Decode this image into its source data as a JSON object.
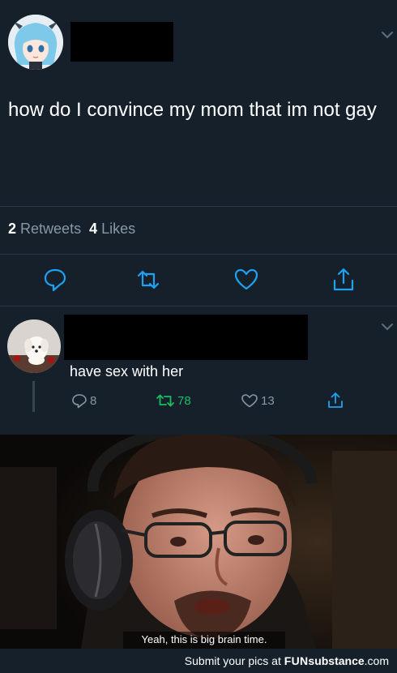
{
  "tweet": {
    "text": "how do I convince my mom that im not gay",
    "retweets_count": "2",
    "retweets_label": "Retweets",
    "likes_count": "4",
    "likes_label": "Likes"
  },
  "reply": {
    "text": "have sex with her",
    "replies": "8",
    "retweets": "78",
    "likes": "13"
  },
  "meme": {
    "caption": "Yeah, this is big brain time."
  },
  "footer": {
    "prefix": "Submit your pics at ",
    "brand_fun": "FUN",
    "brand_rest": "substance",
    "brand_tld": ".com"
  },
  "colors": {
    "background": "#15202b",
    "secondary_text": "#8899a6",
    "retweet_green": "#17bf63",
    "icon_blue": "#1da1f2"
  },
  "icons": [
    "chevron-down-icon",
    "reply-icon",
    "retweet-icon",
    "like-icon",
    "share-icon"
  ]
}
